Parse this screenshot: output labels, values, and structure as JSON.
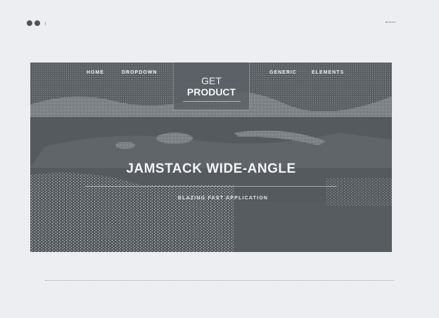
{
  "nav": {
    "home": "HOME",
    "dropdown": "DROPDOWN",
    "generic": "GENERIC",
    "elements": "ELEMENTS"
  },
  "cta": {
    "line1": "GET",
    "line2": "PRODUCT"
  },
  "hero": {
    "title": "JAMSTACK WIDE-ANGLE",
    "subtitle": "BLAZING FAST APPLICATION"
  },
  "icons": {
    "window_controls": "window-dots-icon",
    "menu": "menu-dashes-icon"
  },
  "colors": {
    "page_background": "#eceef1",
    "hero_overlay": "#575c61",
    "text_light": "#f4f5f7"
  }
}
